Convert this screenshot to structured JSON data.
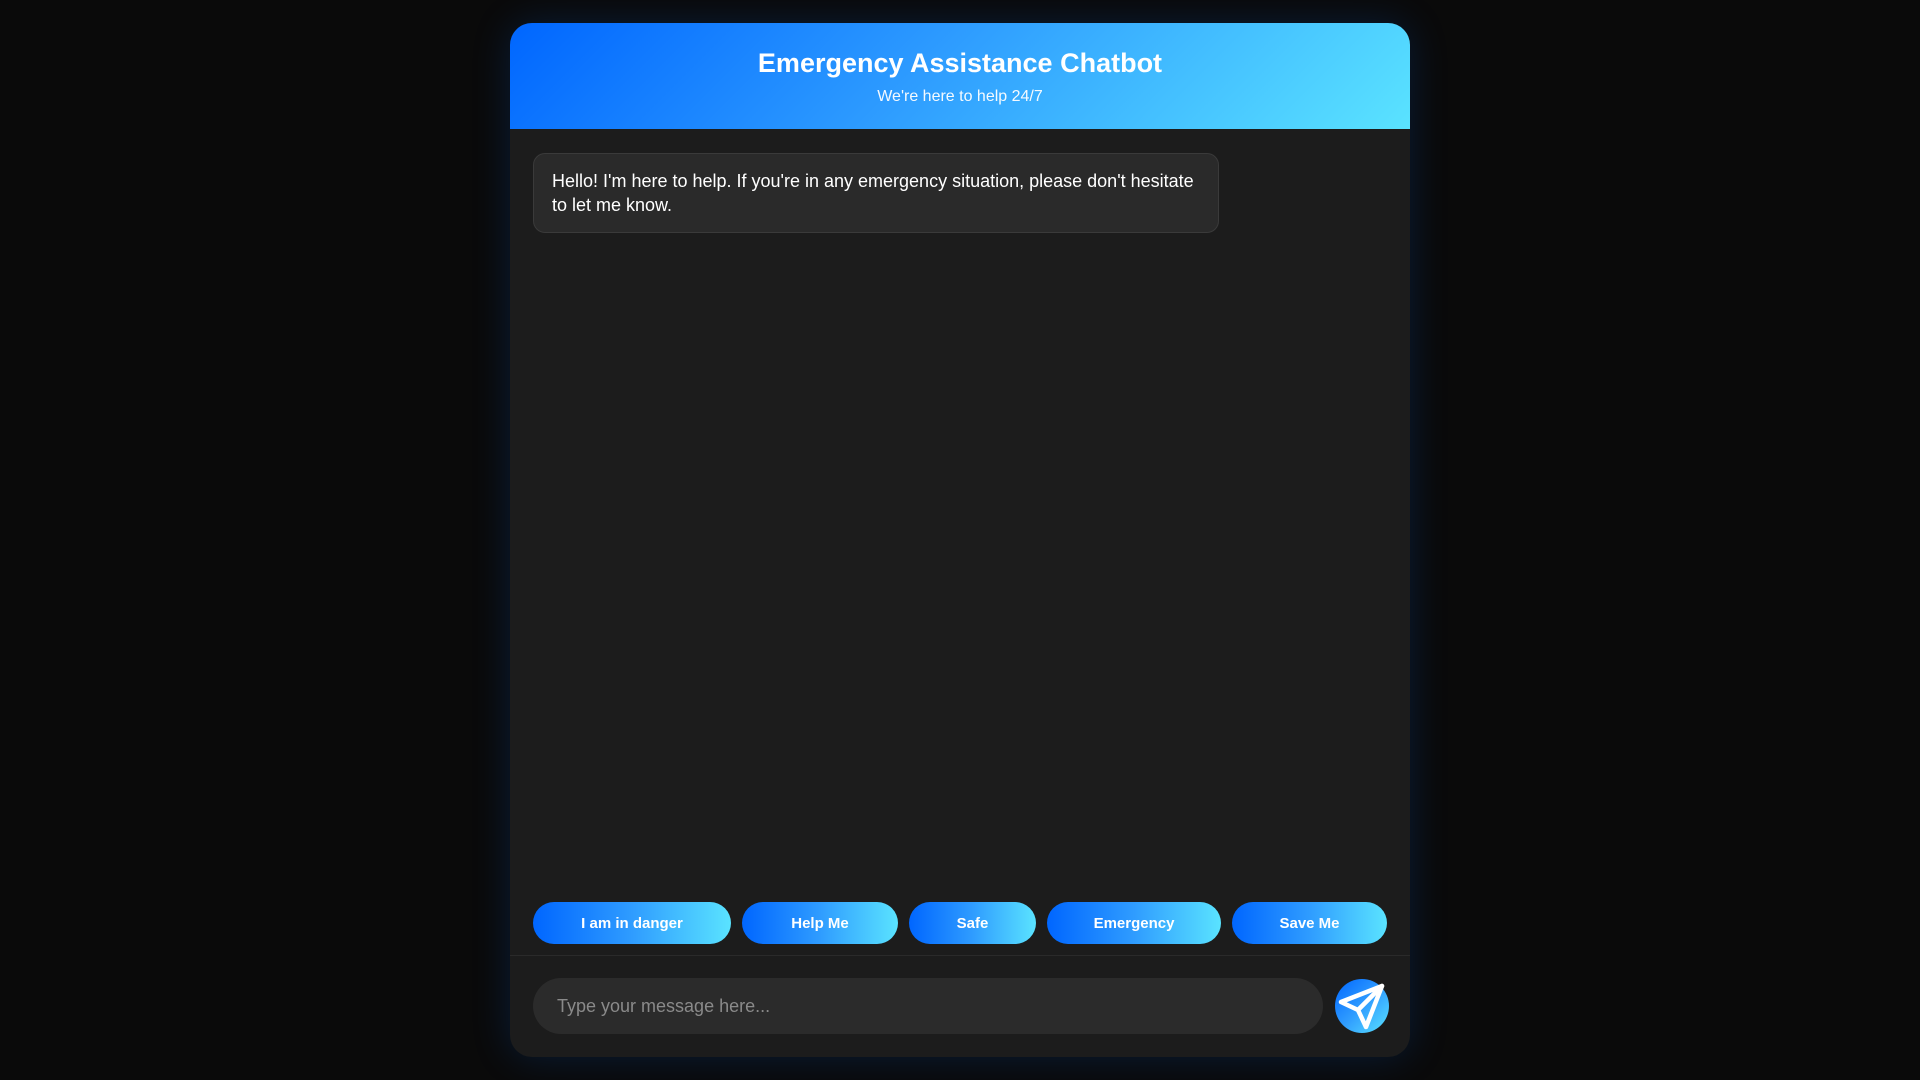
{
  "header": {
    "title": "Emergency Assistance Chatbot",
    "subtitle": "We're here to help 24/7"
  },
  "messages": [
    {
      "sender": "bot",
      "text": "Hello! I'm here to help. If you're in any emergency situation, please don't hesitate to let me know."
    }
  ],
  "quick_replies": [
    {
      "label": "I am in danger"
    },
    {
      "label": "Help Me"
    },
    {
      "label": "Safe"
    },
    {
      "label": "Emergency"
    },
    {
      "label": "Save Me"
    }
  ],
  "input": {
    "placeholder": "Type your message here...",
    "value": ""
  },
  "send_button": {
    "icon": "send-paper-plane-icon"
  },
  "colors": {
    "page_background": "#0a0a0a",
    "window_background": "#1c1c1c",
    "accent_start": "#0066ff",
    "accent_end": "#5ae3ff",
    "bubble_background": "#2a2a2a",
    "input_background": "#2b2b2b"
  }
}
